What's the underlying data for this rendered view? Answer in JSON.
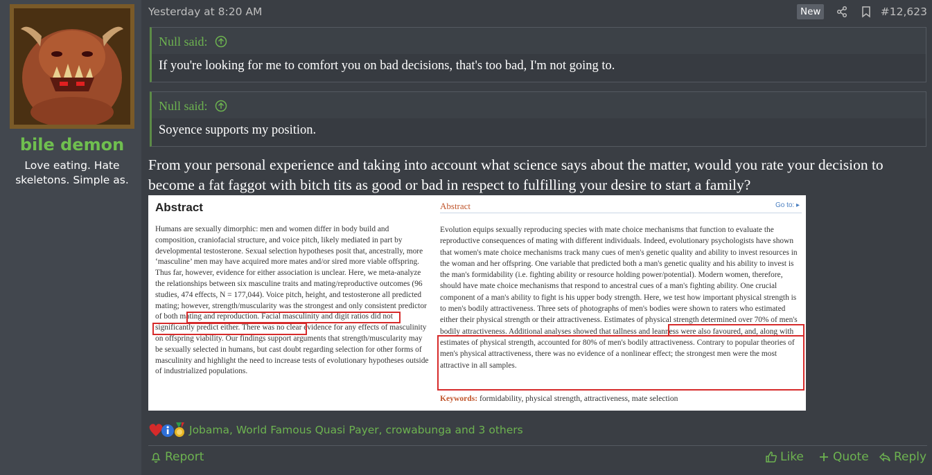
{
  "user": {
    "name": "bile demon",
    "title": "Love eating. Hate skeletons. Simple as."
  },
  "post": {
    "time": "Yesterday at 8:20 AM",
    "new_badge": "New",
    "number": "#12,623"
  },
  "quotes": [
    {
      "author": "Null said:",
      "text": "If you're looking for me to comfort you on bad decisions, that's too bad, I'm not going to."
    },
    {
      "author": "Null said:",
      "text": "Soyence supports my position."
    }
  ],
  "message": "From your personal experience and taking into account what science says about the matter, would you rate your decision to become a fat faggot with bitch tits as good or bad in respect to fulfilling your desire to start a family?",
  "embed": {
    "left_title": "Abstract",
    "left_text": "Humans are sexually dimorphic: men and women differ in body build and composition, craniofacial structure, and voice pitch, likely mediated in part by developmental testosterone. Sexual selection hypotheses posit that, ancestrally, more ‘masculine’ men may have acquired more mates and/or sired more viable offspring. Thus far, however, evidence for either association is unclear. Here, we meta-analyze the relationships between six masculine traits and mating/reproductive outcomes (96 studies, 474 effects, N = 177,044). Voice pitch, height, and testosterone all predicted mating; however, strength/muscularity was the strongest and only consistent predictor of both mating and reproduction. Facial masculinity and digit ratios did not significantly predict either. There was no clear evidence for any effects of masculinity on offspring viability. Our findings support arguments that strength/muscularity may be sexually selected in humans, but cast doubt regarding selection for other forms of masculinity and highlight the need to increase tests of evolutionary hypotheses outside of industrialized populations.",
    "right_title": "Abstract",
    "goto": "Go to: ▸",
    "right_text": "Evolution equips sexually reproducing species with mate choice mechanisms that function to evaluate the reproductive consequences of mating with different individuals. Indeed, evolutionary psychologists have shown that women's mate choice mechanisms track many cues of men's genetic quality and ability to invest resources in the woman and her offspring. One variable that predicted both a man's genetic quality and his ability to invest is the man's formidability (i.e. fighting ability or resource holding power/potential). Modern women, therefore, should have mate choice mechanisms that respond to ancestral cues of a man's fighting ability. One crucial component of a man's ability to fight is his upper body strength. Here, we test how important physical strength is to men's bodily attractiveness. Three sets of photographs of men's bodies were shown to raters who estimated either their physical strength or their attractiveness. Estimates of physical strength determined over 70% of men's bodily attractiveness. Additional analyses showed that tallness and leanness were also favoured, and, along with estimates of physical strength, accounted for 80% of men's bodily attractiveness. Contrary to popular theories of men's physical attractiveness, there was no evidence of a nonlinear effect; the strongest men were the most attractive in all samples.",
    "keywords_label": "Keywords:",
    "keywords_text": "formidability, physical strength, attractiveness, mate selection"
  },
  "reactions": {
    "icons": [
      "heart-icon",
      "info-icon",
      "medal-icon"
    ],
    "text": "Jobama, World Famous Quasi Payer, crowabunga and 3 others"
  },
  "actions": {
    "report": "Report",
    "like": "Like",
    "quote": "Quote",
    "reply": "Reply"
  },
  "colors": {
    "background": "#3a3e44",
    "sidebar": "#42474e",
    "accent_green": "#6db350",
    "username_green": "#6fbf4f",
    "highlight_red": "#d62a2a"
  }
}
